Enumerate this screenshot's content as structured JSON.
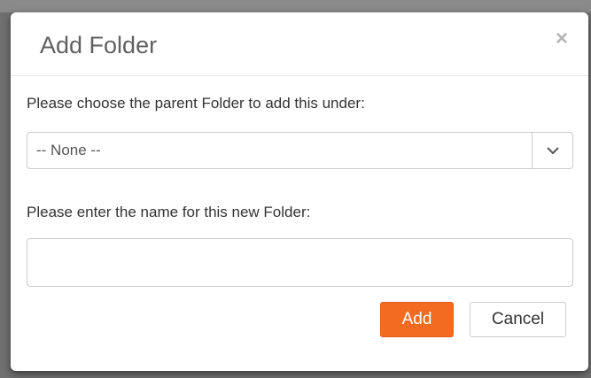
{
  "dialog": {
    "title": "Add Folder",
    "close_symbol": "×"
  },
  "parent_folder": {
    "label": "Please choose the parent Folder to add this under:",
    "selected_value": "-- None --"
  },
  "folder_name": {
    "label": "Please enter the name for this new Folder:",
    "value": "",
    "placeholder": ""
  },
  "buttons": {
    "add_label": "Add",
    "cancel_label": "Cancel"
  },
  "colors": {
    "accent": "#f26b21"
  },
  "icons": {
    "close": "close-icon",
    "dropdown": "chevron-down-icon"
  }
}
